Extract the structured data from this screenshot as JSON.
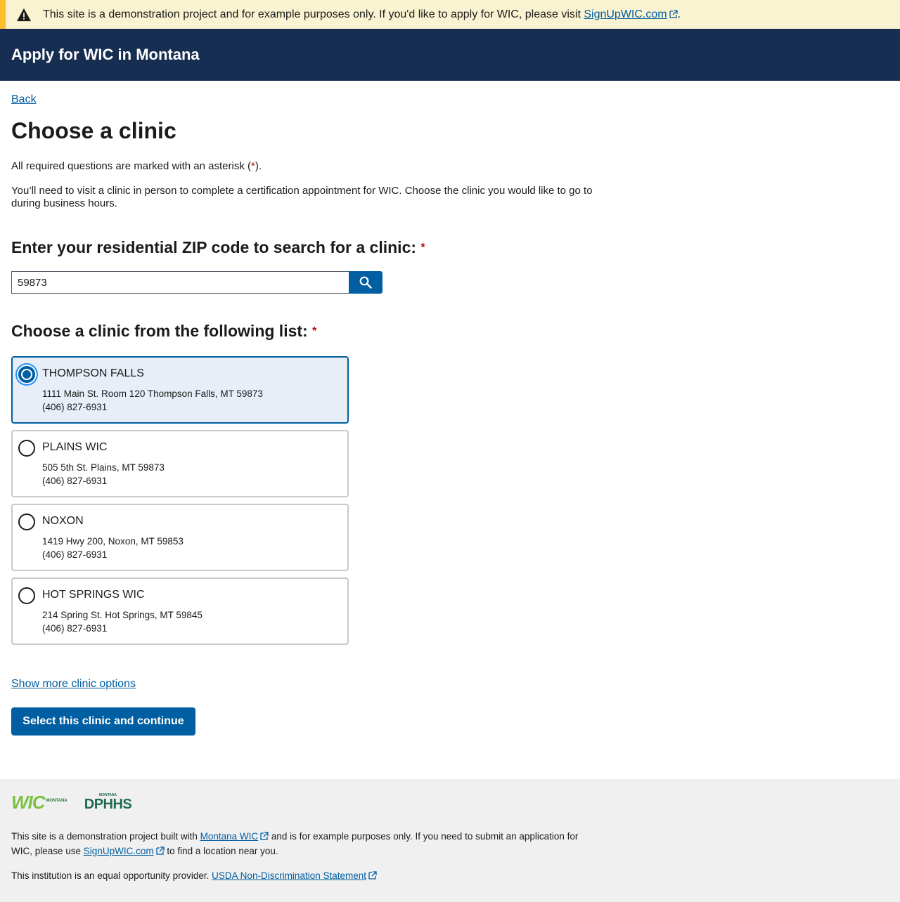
{
  "alert": {
    "text": "This site is a demonstration project and for example purposes only. If you'd like to apply for WIC, please visit ",
    "link": "SignUpWIC.com",
    "after": "."
  },
  "header": {
    "title": "Apply for WIC in Montana"
  },
  "back_link": "Back",
  "page_title": "Choose a clinic",
  "required_note": {
    "before": "All required questions are marked with an asterisk (",
    "asterisk": "*",
    "after": ")."
  },
  "intro": "You’ll need to visit a clinic in person to complete a certification appointment for WIC. Choose the clinic you would like to go to during business hours.",
  "zip_search": {
    "label": "Enter your residential ZIP code to search for a clinic:",
    "asterisk": "*",
    "value": "59873",
    "button_icon": "search-icon"
  },
  "clinic_list": {
    "label": "Choose a clinic from the following list:",
    "asterisk": "*",
    "clinics": [
      {
        "name": "THOMPSON FALLS",
        "address": "1111 Main St. Room 120 Thompson Falls, MT 59873",
        "phone": "(406) 827-6931",
        "selected": true
      },
      {
        "name": "PLAINS WIC",
        "address": "505 5th St. Plains, MT 59873",
        "phone": "(406) 827-6931",
        "selected": false
      },
      {
        "name": "NOXON",
        "address": "1419 Hwy 200, Noxon, MT 59853",
        "phone": "(406) 827-6931",
        "selected": false
      },
      {
        "name": "HOT SPRINGS WIC",
        "address": "214 Spring St. Hot Springs, MT 59845",
        "phone": "(406) 827-6931",
        "selected": false
      }
    ]
  },
  "show_more_link": "Show more clinic options",
  "continue_button": "Select this clinic and continue",
  "footer": {
    "logos": {
      "wic": "WIC",
      "wic_sub": "MONTANA",
      "dphhs": "DPHHS",
      "dphhs_sub": "MONTANA"
    },
    "p1": {
      "before": "This site is a demonstration project built with ",
      "link1": "Montana WIC",
      "middle": " and is for example purposes only. If you need to submit an application for WIC, please use ",
      "link2": "SignUpWIC.com",
      "after": " to find a location near you."
    },
    "p2": {
      "before": "This institution is an equal opportunity provider. ",
      "link": "USDA Non-Discrimination Statement"
    }
  },
  "colors": {
    "primary": "#005ea2",
    "header_bg": "#162e51",
    "alert_bg": "#faf3d1",
    "alert_border": "#ffbe2e",
    "required": "#b50909"
  }
}
